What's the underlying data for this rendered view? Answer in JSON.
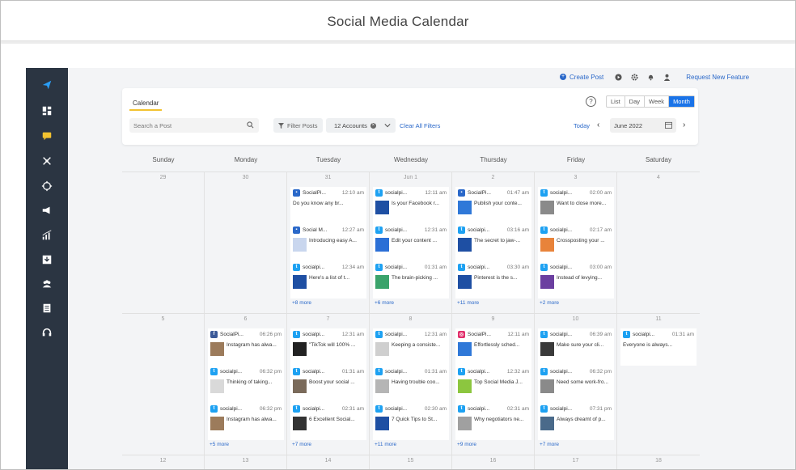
{
  "page_title": "Social Media Calendar",
  "topbar": {
    "create_post": "Create Post",
    "request_feature": "Request New Feature"
  },
  "calendar": {
    "tab_label": "Calendar",
    "search_placeholder": "Search a Post",
    "filter_label": "Filter Posts",
    "accounts_label": "12 Accounts",
    "clear_filters": "Clear All Filters",
    "help": "?",
    "views": [
      "List",
      "Day",
      "Week",
      "Month"
    ],
    "active_view": "Month",
    "today": "Today",
    "current_month": "June 2022"
  },
  "weekdays": [
    "Sunday",
    "Monday",
    "Tuesday",
    "Wednesday",
    "Thursday",
    "Friday",
    "Saturday"
  ],
  "colors": {
    "accent": "#1a73e8",
    "link": "#2a68c9",
    "sidebar": "#2b3542",
    "tab_underline": "#f2c230"
  },
  "weeks": [
    {
      "days": [
        {
          "num": "29",
          "posts": [],
          "more": ""
        },
        {
          "num": "30",
          "posts": [],
          "more": ""
        },
        {
          "num": "31",
          "posts": [
            {
              "net": "sp",
              "acct": "SocialPi...",
              "time": "12:10 am",
              "text": "Do you know any br...",
              "thumb": false
            },
            {
              "net": "sp",
              "acct": "Social M...",
              "time": "12:27 am",
              "text": "Introducing easy A...",
              "thumb": true,
              "thumb_color": "#c9d6ee"
            },
            {
              "net": "tw",
              "acct": "socialpi...",
              "time": "12:34 am",
              "text": "Here's a list of t...",
              "thumb": true,
              "thumb_color": "#1e4fa3"
            }
          ],
          "more": "+8 more"
        },
        {
          "num": "Jun 1",
          "posts": [
            {
              "net": "tw",
              "acct": "socialpi...",
              "time": "12:11 am",
              "text": "Is your Facebook r...",
              "thumb": true,
              "thumb_color": "#1e4fa3"
            },
            {
              "net": "tw",
              "acct": "socialpi...",
              "time": "12:31 am",
              "text": "Edit your content ...",
              "thumb": true,
              "thumb_color": "#2b6fd6"
            },
            {
              "net": "tw",
              "acct": "socialpi...",
              "time": "01:31 am",
              "text": "The brain-picking ...",
              "thumb": true,
              "thumb_color": "#3aa36b"
            }
          ],
          "more": "+6 more"
        },
        {
          "num": "2",
          "posts": [
            {
              "net": "sp",
              "acct": "SocialPi...",
              "time": "01:47 am",
              "text": "Publish your conte...",
              "thumb": true,
              "thumb_color": "#2f78d8"
            },
            {
              "net": "tw",
              "acct": "socialpi...",
              "time": "03:16 am",
              "text": "The secret to jaw-...",
              "thumb": true,
              "thumb_color": "#1e4fa3"
            },
            {
              "net": "tw",
              "acct": "socialpi...",
              "time": "03:30 am",
              "text": "Pinterest is the s...",
              "thumb": true,
              "thumb_color": "#1e4fa3"
            }
          ],
          "more": "+11 more"
        },
        {
          "num": "3",
          "posts": [
            {
              "net": "tw",
              "acct": "socialpi...",
              "time": "02:00 am",
              "text": "Want to close more...",
              "thumb": true,
              "thumb_color": "#8a8a8a"
            },
            {
              "net": "tw",
              "acct": "socialpi...",
              "time": "02:17 am",
              "text": "Crossposting your ...",
              "thumb": true,
              "thumb_color": "#e8833a"
            },
            {
              "net": "tw",
              "acct": "socialpi...",
              "time": "03:00 am",
              "text": "Instead of levying...",
              "thumb": true,
              "thumb_color": "#6b3fa0"
            }
          ],
          "more": "+2 more"
        },
        {
          "num": "4",
          "posts": [],
          "more": ""
        }
      ]
    },
    {
      "days": [
        {
          "num": "5",
          "posts": [],
          "more": ""
        },
        {
          "num": "6",
          "posts": [
            {
              "net": "fb",
              "acct": "SocialPi...",
              "time": "06:26 pm",
              "text": "Instagram has alwa...",
              "thumb": true,
              "thumb_color": "#9c7b5b"
            },
            {
              "net": "tw",
              "acct": "socialpi...",
              "time": "06:32 pm",
              "text": "Thinking of taking...",
              "thumb": true,
              "thumb_color": "#d9d9d9"
            },
            {
              "net": "tw",
              "acct": "socialpi...",
              "time": "06:32 pm",
              "text": "Instagram has alwa...",
              "thumb": true,
              "thumb_color": "#9c7b5b"
            }
          ],
          "more": "+5 more"
        },
        {
          "num": "7",
          "posts": [
            {
              "net": "tw",
              "acct": "socialpi...",
              "time": "12:31 am",
              "text": "\"TikTok will 100% ...",
              "thumb": true,
              "thumb_color": "#222222"
            },
            {
              "net": "tw",
              "acct": "socialpi...",
              "time": "01:31 am",
              "text": "Boost your social ...",
              "thumb": true,
              "thumb_color": "#7a6a5a"
            },
            {
              "net": "tw",
              "acct": "socialpi...",
              "time": "02:31 am",
              "text": "6 Excellent Social...",
              "thumb": true,
              "thumb_color": "#333333"
            }
          ],
          "more": "+7 more"
        },
        {
          "num": "8",
          "posts": [
            {
              "net": "tw",
              "acct": "socialpi...",
              "time": "12:31 am",
              "text": "Keeping a consiste...",
              "thumb": true,
              "thumb_color": "#cfcfcf"
            },
            {
              "net": "tw",
              "acct": "socialpi...",
              "time": "01:31 am",
              "text": "Having trouble coo...",
              "thumb": true,
              "thumb_color": "#b5b5b5"
            },
            {
              "net": "tw",
              "acct": "socialpi...",
              "time": "02:30 am",
              "text": "7 Quick Tips to St...",
              "thumb": true,
              "thumb_color": "#1e4fa3"
            }
          ],
          "more": "+11 more"
        },
        {
          "num": "9",
          "posts": [
            {
              "net": "ig",
              "acct": "SocialPi...",
              "time": "12:11 am",
              "text": "Effortlessly sched...",
              "thumb": true,
              "thumb_color": "#2f78d8"
            },
            {
              "net": "tw",
              "acct": "socialpi...",
              "time": "12:32 am",
              "text": "Top Social Media J...",
              "thumb": true,
              "thumb_color": "#8cc63f"
            },
            {
              "net": "tw",
              "acct": "socialpi...",
              "time": "02:31 am",
              "text": "Why negotiators ne...",
              "thumb": true,
              "thumb_color": "#a0a0a0"
            }
          ],
          "more": "+9 more"
        },
        {
          "num": "10",
          "posts": [
            {
              "net": "tw",
              "acct": "socialpi...",
              "time": "06:39 am",
              "text": "Make sure your cli...",
              "thumb": true,
              "thumb_color": "#3a3a3a"
            },
            {
              "net": "tw",
              "acct": "socialpi...",
              "time": "06:32 pm",
              "text": "Need some work-fro...",
              "thumb": true,
              "thumb_color": "#8a8a8a"
            },
            {
              "net": "tw",
              "acct": "socialpi...",
              "time": "07:31 pm",
              "text": "Always dreamt of p...",
              "thumb": true,
              "thumb_color": "#4a6a8a"
            }
          ],
          "more": "+7 more"
        },
        {
          "num": "11",
          "posts": [
            {
              "net": "tw",
              "acct": "socialpi...",
              "time": "01:31 am",
              "text": "Everyone is always...",
              "thumb": false
            }
          ],
          "more": ""
        }
      ]
    },
    {
      "days": [
        {
          "num": "12",
          "posts": [],
          "more": ""
        },
        {
          "num": "13",
          "posts": [],
          "more": ""
        },
        {
          "num": "14",
          "posts": [],
          "more": ""
        },
        {
          "num": "15",
          "posts": [],
          "more": ""
        },
        {
          "num": "16",
          "posts": [],
          "more": ""
        },
        {
          "num": "17",
          "posts": [],
          "more": ""
        },
        {
          "num": "18",
          "posts": [],
          "more": ""
        }
      ]
    }
  ]
}
